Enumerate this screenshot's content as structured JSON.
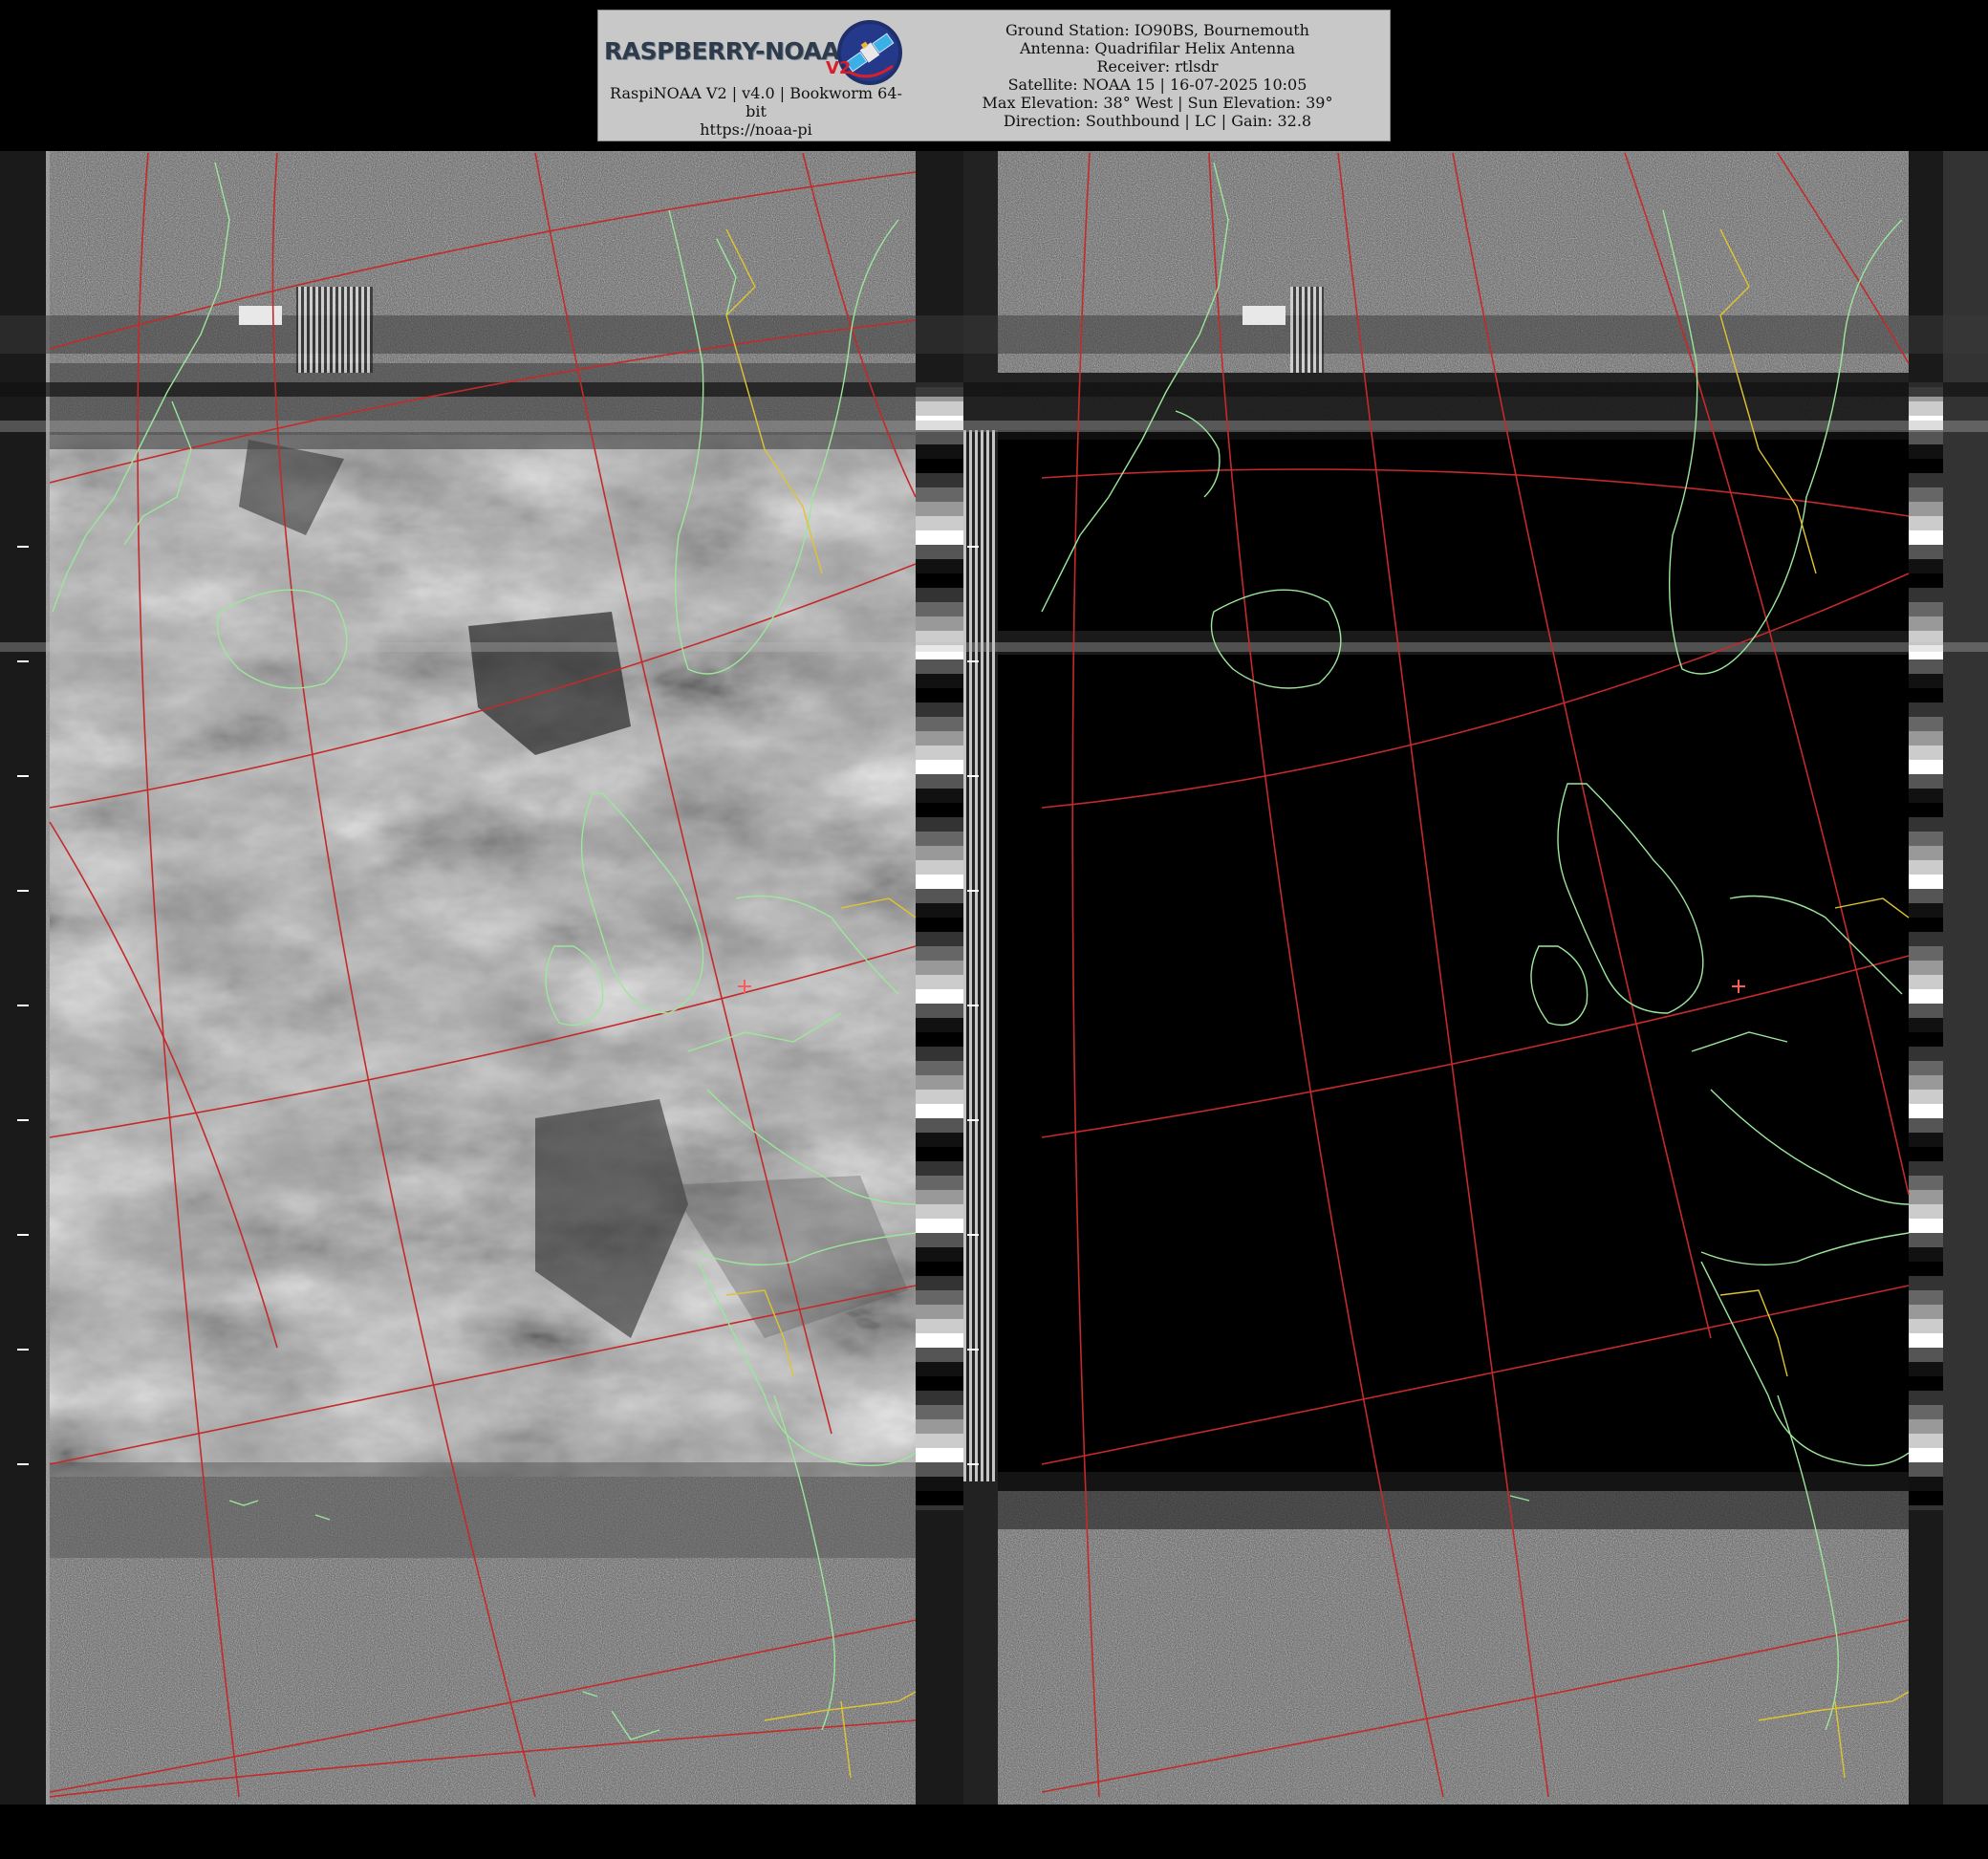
{
  "header": {
    "logo": {
      "text_main": "RASPBERRY-NOAA",
      "text_version": "V2"
    },
    "left_info": {
      "line1": "RaspiNOAA V2 | v4.0 | Bookworm 64-",
      "line2": "bit",
      "line3": "https://noaa-pi"
    },
    "right_info": {
      "ground_station": "Ground Station: IO90BS, Bournemouth",
      "antenna": "Antenna: Quadrifilar Helix Antenna",
      "receiver": "Receiver: rtlsdr",
      "satellite": "Satellite: NOAA 15 | 16-07-2025 10:05",
      "elevation": "Max Elevation: 38° West | Sun Elevation: 39°",
      "direction": "Direction: Southbound | LC | Gain: 32.8"
    }
  },
  "image": {
    "type": "APT satellite capture, two channels side by side",
    "left_channel": "visible — clouds over North Atlantic and Europe",
    "right_channel": "infrared — dark sea with coastline overlay",
    "overlay_colors": {
      "graticule": "#c42a2a",
      "coastline": "#9be79b",
      "borders": "#e0c430",
      "station_marker": "#ff5a5a"
    }
  }
}
